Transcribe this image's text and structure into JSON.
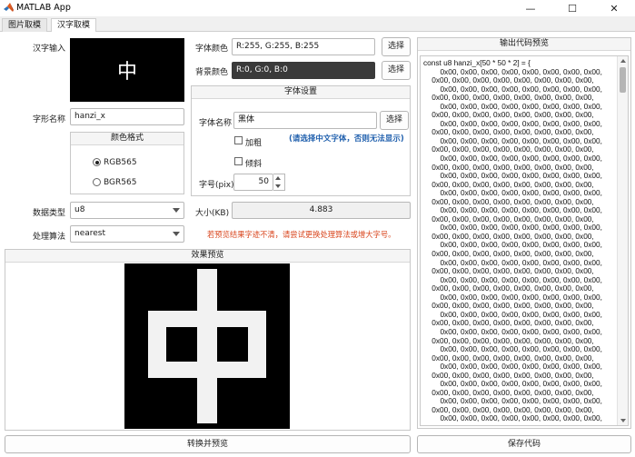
{
  "window": {
    "title": "MATLAB App",
    "minimize_glyph": "—",
    "maximize_glyph": "☐",
    "close_glyph": "✕"
  },
  "tabs": [
    {
      "label": "图片取模"
    },
    {
      "label": "汉字取模"
    }
  ],
  "left": {
    "char_input_label": "汉字输入",
    "char_preview": "中",
    "font_color_label": "字体颜色",
    "font_color_value": "R:255, G:255, B:255",
    "font_color_button": "选择",
    "bg_color_label": "背景颜色",
    "bg_color_value": "R:0, G:0, B:0",
    "bg_color_button": "选择",
    "glyph_name_label": "字形名称",
    "glyph_name_value": "hanzi_x",
    "color_format": {
      "title": "颜色格式",
      "options": [
        "RGB565",
        "BGR565"
      ],
      "selected": "RGB565"
    },
    "font_settings": {
      "title": "字体设置",
      "font_name_label": "字体名称",
      "font_name_value": "黑体",
      "font_name_button": "选择",
      "hint": "(请选择中文字体，否则无法显示)",
      "bold_label": "加粗",
      "italic_label": "倾斜",
      "size_label": "字号(pix)",
      "size_value": "50"
    },
    "data_type_label": "数据类型",
    "data_type_value": "u8",
    "algorithm_label": "处理算法",
    "algorithm_value": "nearest",
    "size_kb_label": "大小(KB)",
    "size_kb_value": "4.883",
    "warning": "若预览结果字迹不清，请尝试更换处理算法或增大字号。",
    "preview_title": "效果预览",
    "convert_button": "转换并预览"
  },
  "right": {
    "title": "输出代码预览",
    "code_header": "const u8 hanzi_x[50 * 50 * 2] = {",
    "code_row_a": "        0x00, 0x00, 0x00, 0x00, 0x00, 0x00, 0x00, 0x00,",
    "code_row_b": "    0x00, 0x00, 0x00, 0x00, 0x00, 0x00, 0x00, 0x00,",
    "save_button": "保存代码"
  },
  "colors": {
    "accent_text": "#1f5fad",
    "warning_text": "#d9461e"
  }
}
